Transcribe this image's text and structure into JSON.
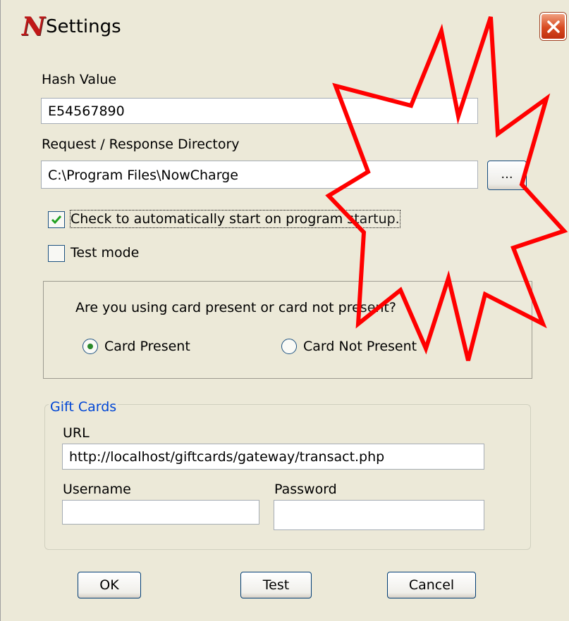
{
  "window": {
    "title": "Settings",
    "logo_letter": "N"
  },
  "hash": {
    "label": "Hash Value",
    "value": "E54567890"
  },
  "directory": {
    "label": "Request / Response Directory",
    "value": "C:\\Program Files\\NowCharge",
    "browse_label": "..."
  },
  "options": {
    "autostart_label": "Check to automatically start on program startup.",
    "autostart_checked": true,
    "testmode_label": "Test mode",
    "testmode_checked": false
  },
  "card_mode": {
    "question": "Are you using card present or card not present?",
    "present_label": "Card Present",
    "not_present_label": "Card Not Present",
    "selected": "Card Present"
  },
  "gift_cards": {
    "legend": "Gift Cards",
    "url_label": "URL",
    "url_value": "http://localhost/giftcards/gateway/transact.php",
    "username_label": "Username",
    "username_value": "",
    "password_label": "Password",
    "password_value": ""
  },
  "buttons": {
    "ok": "OK",
    "test": "Test",
    "cancel": "Cancel"
  },
  "colors": {
    "window_bg": "#ece9d8",
    "burst_stroke": "#ff0000",
    "legend_text": "#0046d5",
    "close_button": "#d84a20"
  }
}
